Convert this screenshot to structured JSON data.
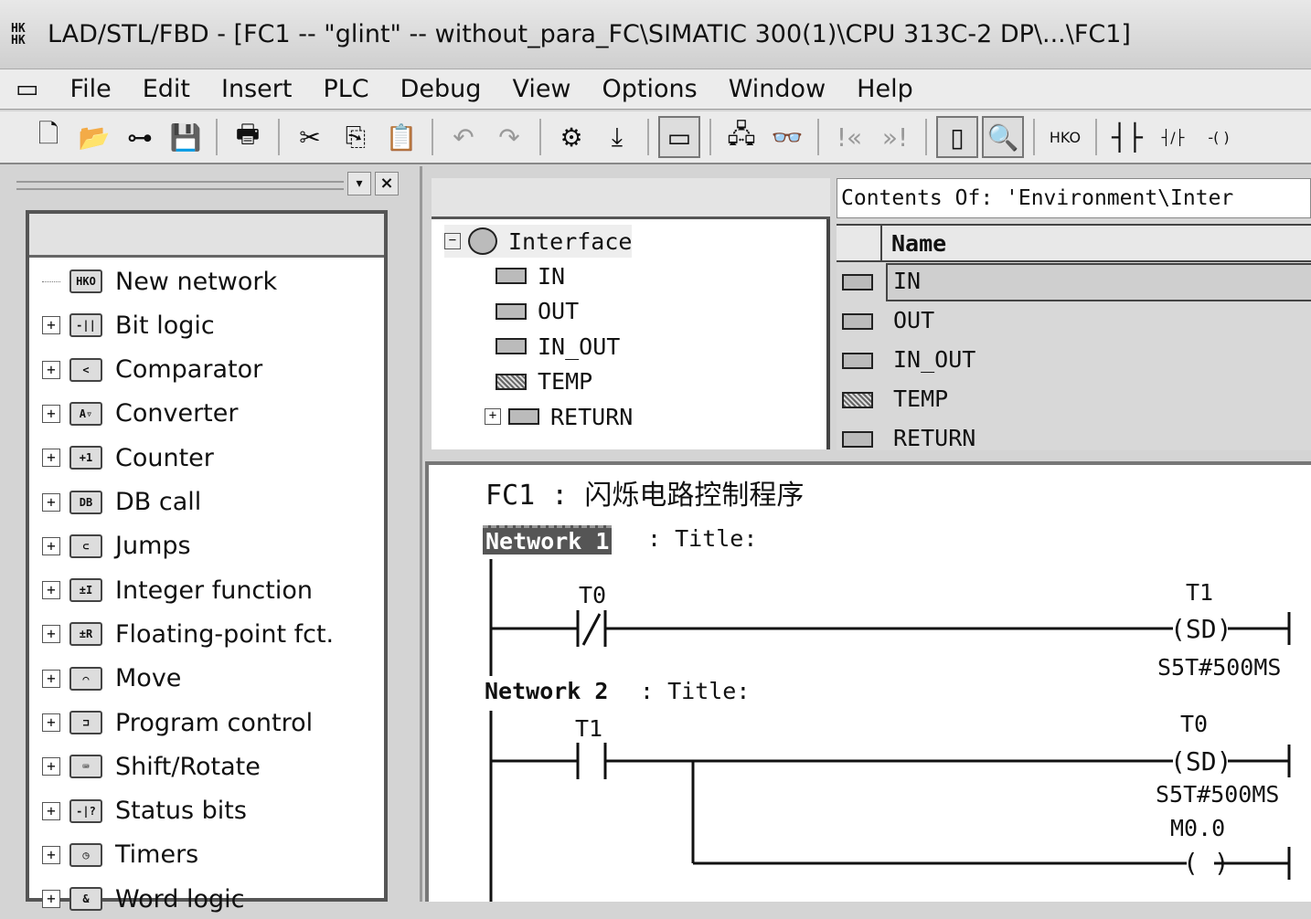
{
  "window": {
    "title": "LAD/STL/FBD  - [FC1 -- \"glint\" -- without_para_FC\\SIMATIC 300(1)\\CPU 313C-2 DP\\...\\FC1]",
    "logo": "HKO"
  },
  "menu": [
    "File",
    "Edit",
    "Insert",
    "PLC",
    "Debug",
    "View",
    "Options",
    "Window",
    "Help"
  ],
  "toolbar": [
    {
      "icon": "new-icon",
      "glyph": "🗋"
    },
    {
      "icon": "open-icon",
      "glyph": "📂"
    },
    {
      "icon": "accessible-nodes-icon",
      "glyph": "⊶"
    },
    {
      "icon": "save-icon",
      "glyph": "💾"
    },
    {
      "icon": "print-icon",
      "glyph": "🖶"
    },
    {
      "icon": "cut-icon",
      "glyph": "✂"
    },
    {
      "icon": "copy-icon",
      "glyph": "⎘"
    },
    {
      "icon": "paste-icon",
      "glyph": "📋"
    },
    {
      "icon": "undo-icon",
      "glyph": "↶"
    },
    {
      "icon": "redo-icon",
      "glyph": "↷"
    },
    {
      "icon": "compile-icon",
      "glyph": "⚙"
    },
    {
      "icon": "download-icon",
      "glyph": "⤓"
    },
    {
      "icon": "overview-icon",
      "glyph": "▭"
    },
    {
      "icon": "online-icon",
      "glyph": "🖧"
    },
    {
      "icon": "monitor-icon",
      "glyph": "👓"
    },
    {
      "icon": "previous-network-icon",
      "glyph": "!«"
    },
    {
      "icon": "next-network-icon",
      "glyph": "»!"
    },
    {
      "icon": "overview-window-icon",
      "glyph": "▯"
    },
    {
      "icon": "details-window-icon",
      "glyph": "🔍"
    },
    {
      "icon": "new-network-icon",
      "glyph": "HKO"
    },
    {
      "icon": "normally-open-contact-icon",
      "glyph": "┤├"
    },
    {
      "icon": "normally-closed-contact-icon",
      "glyph": "┤/├"
    },
    {
      "icon": "coil-icon",
      "glyph": "-( )"
    }
  ],
  "catalog": {
    "items": [
      {
        "label": "New network",
        "icon": "new-network-icon",
        "glyph": "HKO",
        "expandable": false
      },
      {
        "label": "Bit logic",
        "icon": "bit-logic-icon",
        "glyph": "-||",
        "expandable": true
      },
      {
        "label": "Comparator",
        "icon": "comparator-icon",
        "glyph": "<",
        "expandable": true
      },
      {
        "label": "Converter",
        "icon": "converter-icon",
        "glyph": "A▿",
        "expandable": true
      },
      {
        "label": "Counter",
        "icon": "counter-icon",
        "glyph": "+1",
        "expandable": true
      },
      {
        "label": "DB call",
        "icon": "db-call-icon",
        "glyph": "DB",
        "expandable": true
      },
      {
        "label": "Jumps",
        "icon": "jumps-icon",
        "glyph": "⊂",
        "expandable": true
      },
      {
        "label": "Integer function",
        "icon": "integer-function-icon",
        "glyph": "±I",
        "expandable": true
      },
      {
        "label": "Floating-point fct.",
        "icon": "floating-point-icon",
        "glyph": "±R",
        "expandable": true
      },
      {
        "label": "Move",
        "icon": "move-icon",
        "glyph": "⌒",
        "expandable": true
      },
      {
        "label": "Program control",
        "icon": "program-control-icon",
        "glyph": "⊐",
        "expandable": true
      },
      {
        "label": "Shift/Rotate",
        "icon": "shift-rotate-icon",
        "glyph": "⌨",
        "expandable": true
      },
      {
        "label": "Status bits",
        "icon": "status-bits-icon",
        "glyph": "-|?",
        "expandable": true
      },
      {
        "label": "Timers",
        "icon": "timers-icon",
        "glyph": "◷",
        "expandable": true
      },
      {
        "label": "Word logic",
        "icon": "word-logic-icon",
        "glyph": "&",
        "expandable": true
      }
    ]
  },
  "interface": {
    "root": "Interface",
    "children": [
      "IN",
      "OUT",
      "IN_OUT",
      "TEMP",
      "RETURN"
    ]
  },
  "contents": {
    "header": "Contents Of: 'Environment\\Inter",
    "column": "Name",
    "rows": [
      "IN",
      "OUT",
      "IN_OUT",
      "TEMP",
      "RETURN"
    ],
    "selected": "IN"
  },
  "editor": {
    "block_title": "FC1 : 闪烁电路控制程序",
    "networks": [
      {
        "label": "Network 1",
        "title": ": Title:",
        "contact": "T0",
        "contact_type": "normally-closed",
        "coil": "T1",
        "coil_type": "SD",
        "coil_value": "S5T#500MS",
        "coil_glyph": "(SD)"
      },
      {
        "label": "Network 2",
        "title": ": Title:",
        "contact": "T1",
        "contact_type": "normally-open",
        "coil": "T0",
        "coil_type": "SD",
        "coil_value": "S5T#500MS",
        "coil_glyph": "(SD)",
        "coil2": "M0.0",
        "coil2_glyph": "( )"
      }
    ]
  }
}
